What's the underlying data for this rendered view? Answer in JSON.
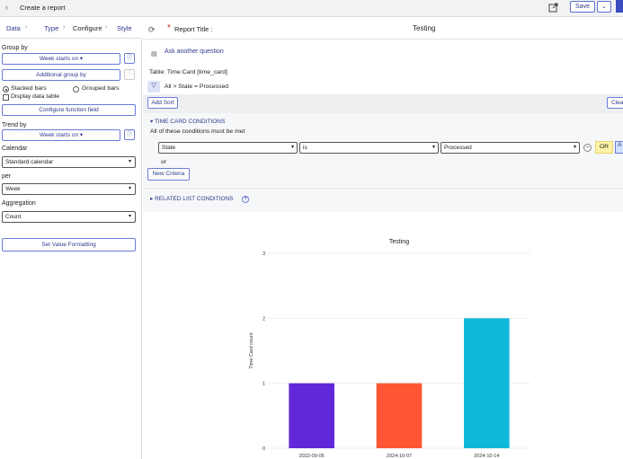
{
  "header": {
    "back_glyph": "‹",
    "title": "Create a report",
    "save_label": "Save",
    "save_dropdown_glyph": "⌄"
  },
  "tabs": [
    {
      "label": "Data"
    },
    {
      "label": "Type"
    },
    {
      "label": "Configure"
    },
    {
      "label": "Style"
    }
  ],
  "config": {
    "group_by_label": "Group by",
    "group_by_value": "Week starts on",
    "additional_group_by": "Additional group by",
    "stacked_bars": "Stacked bars",
    "grouped_bars": "Grouped bars",
    "display_data_table": "Display data table",
    "configure_function_field": "Configure function field",
    "trend_by_label": "Trend by",
    "trend_by_value": "Week starts on",
    "calendar_label": "Calendar",
    "calendar_value": "Standard calendar",
    "per_label": "per",
    "per_value": "Week",
    "aggregation_label": "Aggregation",
    "aggregation_value": "Count",
    "set_value_formatting": "Set Value Formatting",
    "info_glyph": "ⓘ"
  },
  "report": {
    "title_label": "Report Title :",
    "title_value": "Testing",
    "required_mark": "*",
    "ask_another": "Ask another question",
    "table_label": "Table: Time Card [time_card]",
    "breadcrumb": "All > State = Processed",
    "add_sort": "Add Sort",
    "clear_partial": "Clea",
    "time_card_conditions": "TIME CARD CONDITIONS",
    "all_conditions_note": "All of these conditions must be met",
    "cond_field": "State",
    "cond_operator": "is",
    "cond_value": "Processed",
    "or_label": "OR",
    "and_partial": "A",
    "or_separator": "or",
    "new_criteria": "New Criteria",
    "related_list_conditions": "RELATED LIST CONDITIONS",
    "help_glyph": "?"
  },
  "icons": {
    "back": "chevron-left-icon",
    "share": "share-icon",
    "refresh": "refresh-icon",
    "ask": "chat-icon",
    "filter": "filter-icon",
    "info": "info-icon",
    "help": "help-icon"
  },
  "colors": {
    "accent": "#2e3a8c",
    "brand": "#3a4cc0",
    "bar1": "#6128d9",
    "bar2": "#ff5533",
    "bar3": "#0fb8d9"
  },
  "chart_data": {
    "type": "bar",
    "title": "Testing",
    "ylabel": "Time Card count",
    "xlabel": "",
    "categories": [
      "2022-09-05",
      "2024-10-07",
      "2024-10-14"
    ],
    "values": [
      1,
      1,
      2
    ],
    "colors": [
      "#6128d9",
      "#ff5533",
      "#0fb8d9"
    ],
    "ylim": [
      0,
      3
    ],
    "yticks": [
      0,
      1,
      2,
      3
    ],
    "grid": true,
    "legend": "none"
  }
}
